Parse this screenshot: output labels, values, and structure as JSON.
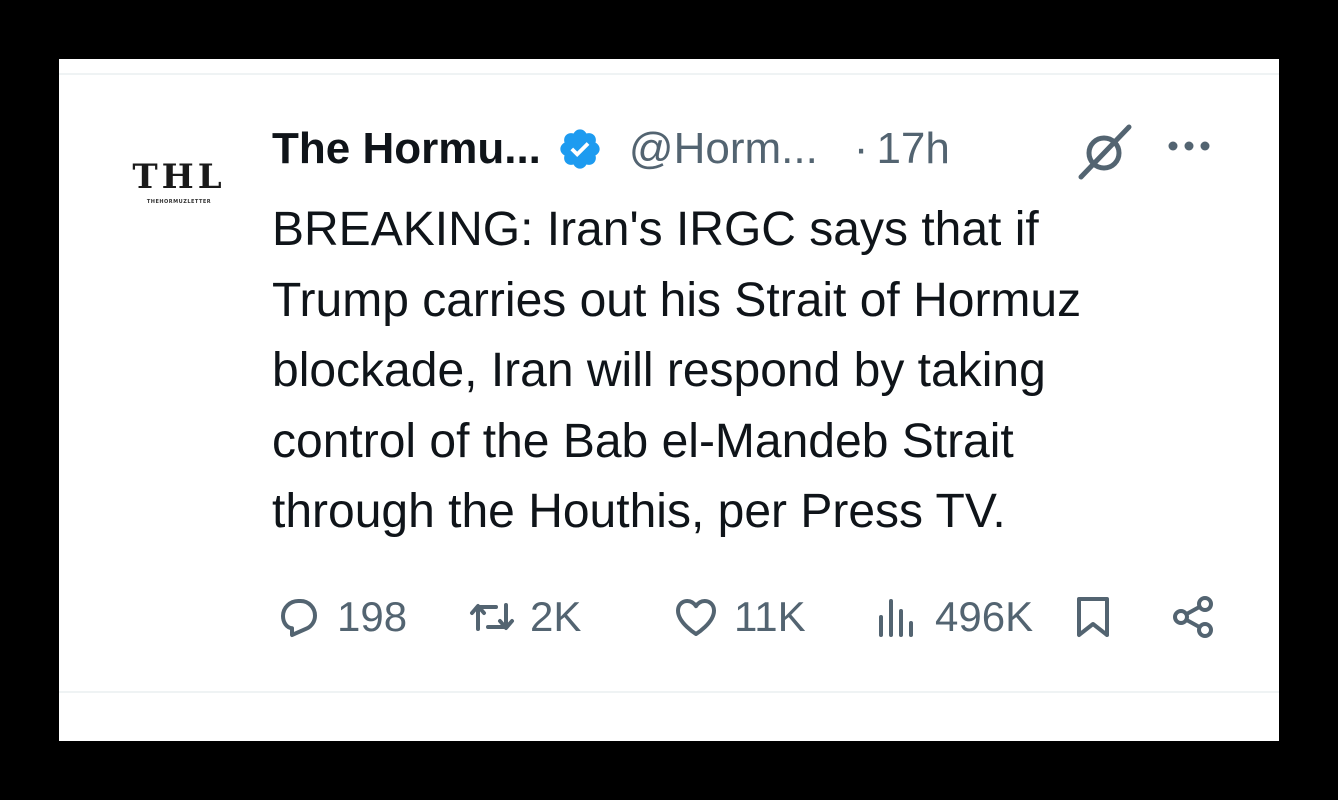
{
  "tweet": {
    "avatar_text": "THL",
    "avatar_subtext": "THEHORMUZLETTER",
    "display_name": "The Hormu...",
    "handle": "@Horm...",
    "dot": "·",
    "time": "17h",
    "lines": [
      "BREAKING: Iran's IRGC says that if",
      "Trump carries out his Strait of Hormuz",
      "blockade, Iran will respond by taking",
      "control of the Bab el-Mandeb Strait",
      "through the Houthis, per Press TV."
    ],
    "counts": {
      "replies": "198",
      "reposts": "2K",
      "likes": "11K",
      "views": "496K"
    }
  },
  "icons": {
    "verified": "verified-badge-icon",
    "grok": "grok-icon",
    "more": "more-icon",
    "reply": "reply-icon",
    "repost": "repost-icon",
    "like": "heart-icon",
    "views": "views-icon",
    "bookmark": "bookmark-icon",
    "share": "share-icon"
  },
  "colors": {
    "verified": "#1d9bf0",
    "text": "#0f1419",
    "secondary": "#536471"
  }
}
